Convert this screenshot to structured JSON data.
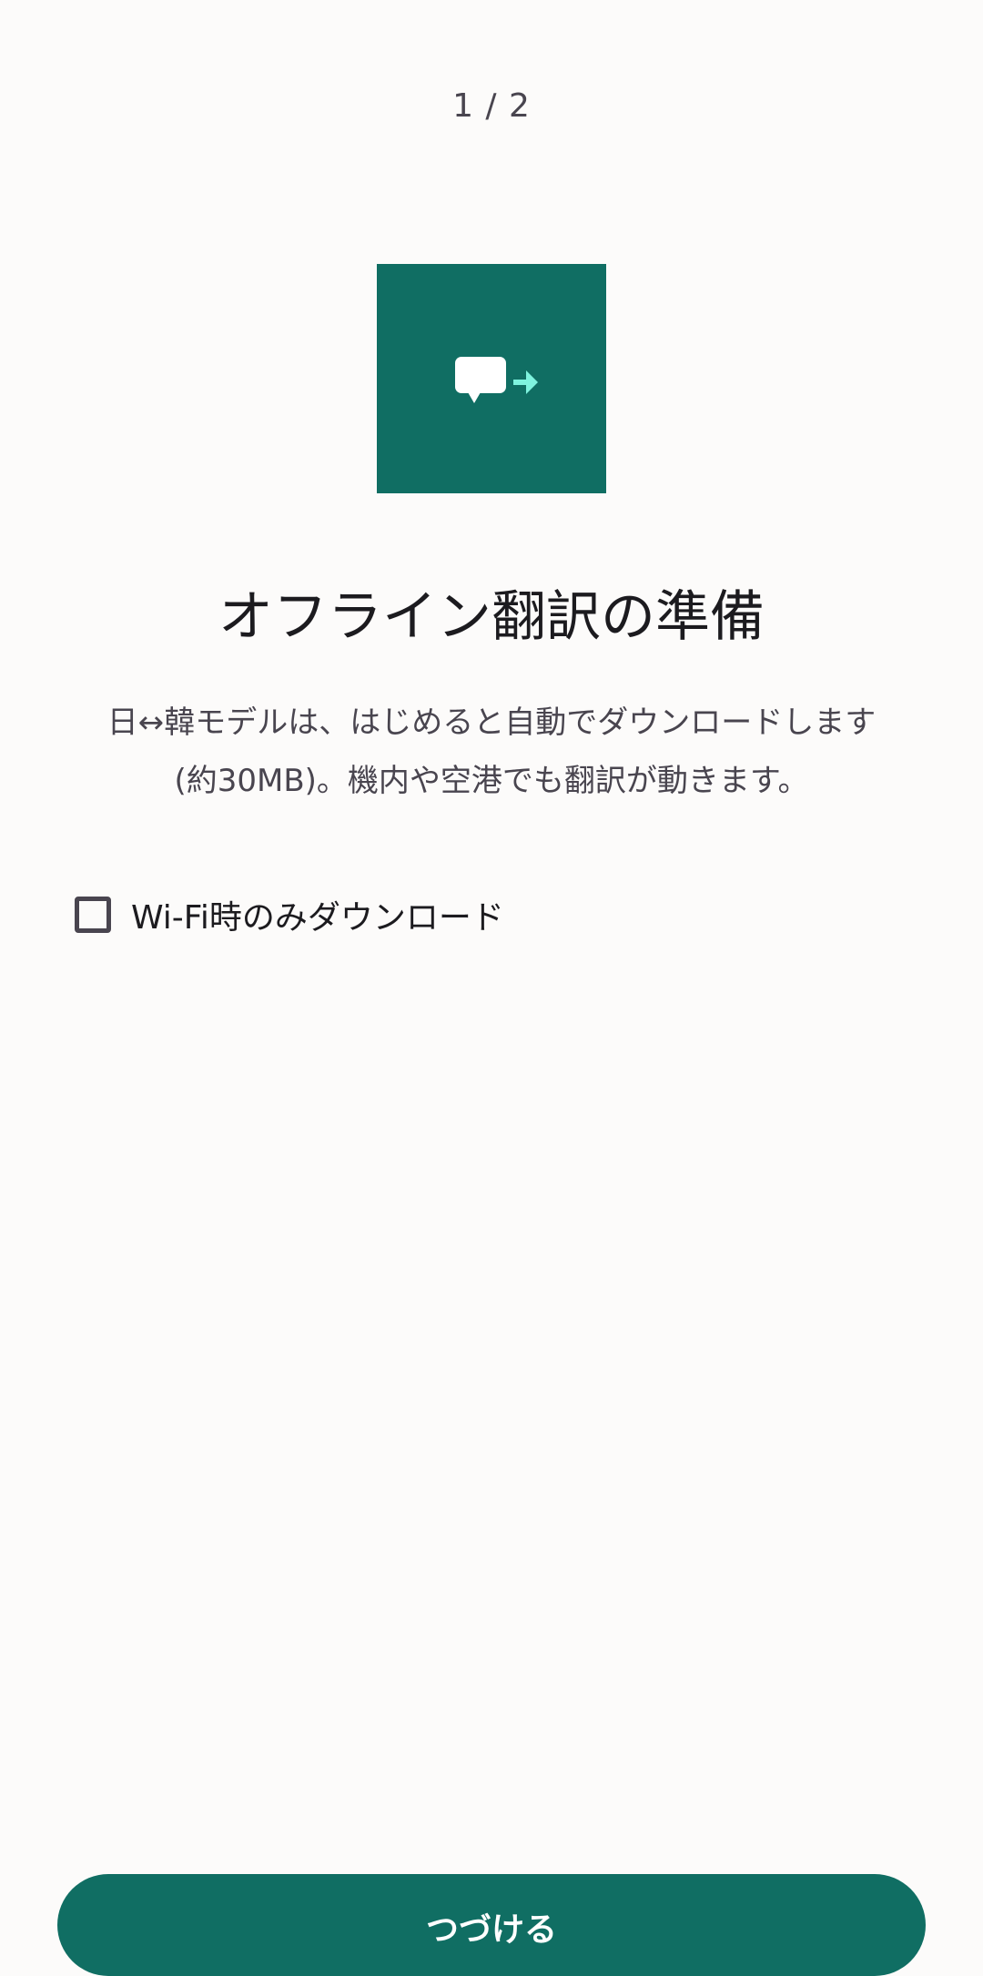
{
  "header": {
    "step_indicator": "1 / 2"
  },
  "hero": {
    "icon": "chat-bubble-arrow-icon",
    "background_color": "#106e63",
    "arrow_color": "#7ff3de"
  },
  "content": {
    "title": "オフライン翻訳の準備",
    "description_line1": "日↔韓モデルは、はじめると自動でダウンロードします",
    "description_line2": "(約30MB)。機内や空港でも翻訳が動きます。"
  },
  "options": {
    "wifi_only_label": "Wi-Fi時のみダウンロード",
    "wifi_only_checked": false
  },
  "footer": {
    "continue_label": "つづける"
  },
  "colors": {
    "accent": "#106e63",
    "background": "#fcfbfa",
    "text_primary": "#1c1b1f",
    "text_secondary": "#49454f"
  }
}
